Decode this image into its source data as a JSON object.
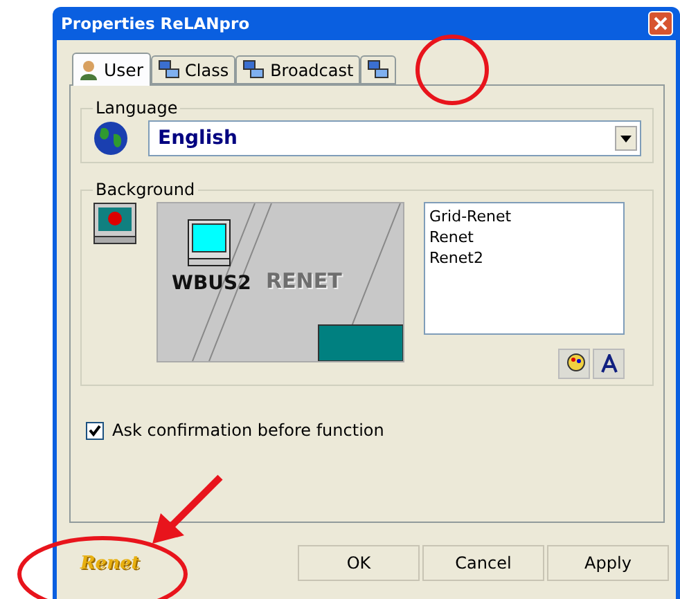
{
  "window": {
    "title": "Properties ReLANpro"
  },
  "tabs": [
    {
      "label": "User",
      "selected": true
    },
    {
      "label": "Class",
      "selected": false
    },
    {
      "label": "Broadcast",
      "selected": false
    },
    {
      "selected": false
    }
  ],
  "language": {
    "label": "Language",
    "value": "English"
  },
  "background": {
    "label": "Background",
    "preview": {
      "computer_label": "WBUS2",
      "watermark": "RENET"
    },
    "items": [
      {
        "label": "Grid-Renet"
      },
      {
        "label": "Renet"
      },
      {
        "label": "Renet2"
      }
    ]
  },
  "confirm": {
    "label": "Ask confirmation before function",
    "checked": true
  },
  "logo": "Renet",
  "buttons": [
    "OK",
    "Cancel",
    "Apply"
  ],
  "annotations": [
    {
      "kind": "circle"
    },
    {
      "kind": "ellipse"
    },
    {
      "kind": "arrow"
    }
  ]
}
